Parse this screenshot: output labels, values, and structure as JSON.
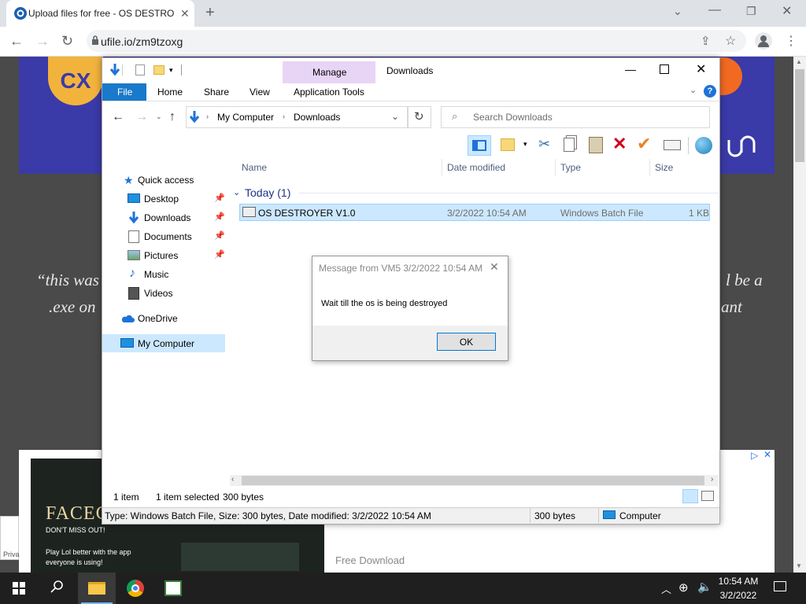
{
  "browser": {
    "tab_title": "Upload files for free - OS DESTROYER",
    "url": "ufile.io/zm9tzoxg"
  },
  "page": {
    "banner_logo": "CX",
    "quote_line1_left": "“this was",
    "quote_line1_right": "l be a",
    "quote_line2_left": ".exe on",
    "quote_line2_right": "ant",
    "ad_title": "FACEC",
    "ad_tag": "DON'T MISS OUT!",
    "ad_text1": "Play Lol better with the app",
    "ad_text2": "everyone is using!",
    "ad_free_download": "Free Download",
    "privacy": "Priva"
  },
  "explorer": {
    "ribbon_context_tab": "Manage",
    "window_title": "Downloads",
    "tabs": [
      "File",
      "Home",
      "Share",
      "View",
      "Application Tools"
    ],
    "breadcrumb": [
      "My Computer",
      "Downloads"
    ],
    "search_placeholder": "Search Downloads",
    "nav": {
      "quick_access": "Quick access",
      "items": [
        "Desktop",
        "Downloads",
        "Documents",
        "Pictures",
        "Music",
        "Videos"
      ],
      "onedrive": "OneDrive",
      "my_computer": "My Computer"
    },
    "columns": [
      "Name",
      "Date modified",
      "Type",
      "Size"
    ],
    "group": "Today (1)",
    "file": {
      "name": "OS DESTROYER V1.0",
      "date": "3/2/2022 10:54 AM",
      "type": "Windows Batch File",
      "size": "1 KB"
    },
    "status": {
      "count": "1 item",
      "selected": "1 item selected",
      "bytes": "300 bytes"
    },
    "details_bar": {
      "info": "Type: Windows Batch File, Size: 300 bytes, Date modified: 3/2/2022 10:54 AM",
      "size": "300 bytes",
      "location": "Computer"
    }
  },
  "dialog": {
    "title": "Message from VM5 3/2/2022 10:54 AM",
    "message": "Wait till the os is being destroyed",
    "ok": "OK"
  },
  "taskbar": {
    "time": "10:54 AM",
    "date": "3/2/2022"
  },
  "colors": {
    "accent": "#0078d7",
    "selection": "#cce8ff",
    "manage_tab": "#e8d4f5",
    "banner": "#3a3aa8"
  }
}
